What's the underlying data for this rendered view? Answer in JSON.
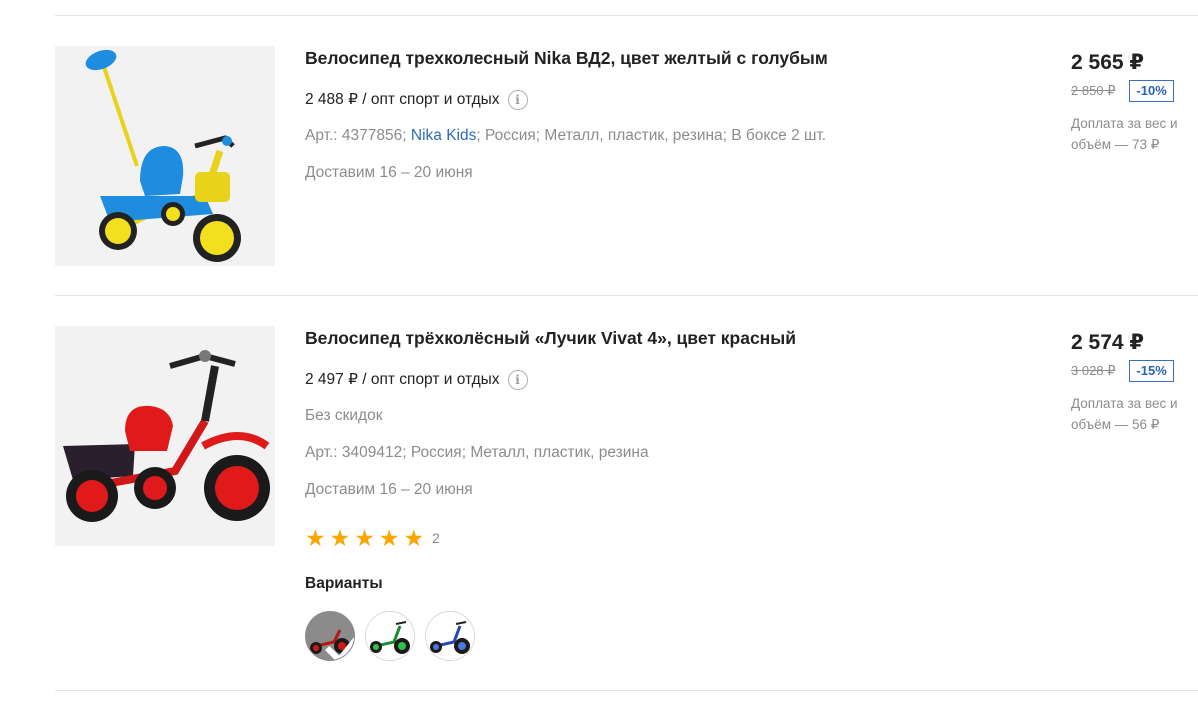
{
  "products": [
    {
      "title": "Велосипед трехколесный Nika ВД2, цвет желтый с голубым",
      "opt_price": "2 488 ₽ / опт спорт и отдых",
      "art_prefix": "Арт.: 4377856;",
      "brand": "Nika Kids",
      "attributes": "; Россия; Металл, пластик, резина; В боксе 2 шт.",
      "delivery": "Доставим 16 – 20 июня",
      "price": "2 565 ₽",
      "old_price": "2 850 ₽",
      "discount": "-10%",
      "surcharge": "Доплата за вес и объём — 73 ₽"
    },
    {
      "title": "Велосипед трёхколёсный «Лучик Vivat 4», цвет красный",
      "opt_price": "2 497 ₽ / опт спорт и отдых",
      "no_discounts": "Без скидок",
      "art": "Арт.: 3409412; Россия; Металл, пластик, резина",
      "delivery": "Доставим 16 – 20 июня",
      "rating": 5,
      "reviews_count": "2",
      "variants_label": "Варианты",
      "variants": [
        {
          "color": "red",
          "selected": true
        },
        {
          "color": "green",
          "selected": false
        },
        {
          "color": "blue",
          "selected": false
        }
      ],
      "price": "2 574 ₽",
      "old_price": "3 028 ₽",
      "discount": "-15%",
      "surcharge": "Доплата за вес и объём — 56 ₽"
    }
  ],
  "colors": {
    "link": "#2d6bc1",
    "star": "#fba500",
    "discount_border": "#3a6fc4",
    "muted_text": "#8c8c8c"
  },
  "icons": [
    "info-icon",
    "star-icon",
    "check-icon"
  ]
}
